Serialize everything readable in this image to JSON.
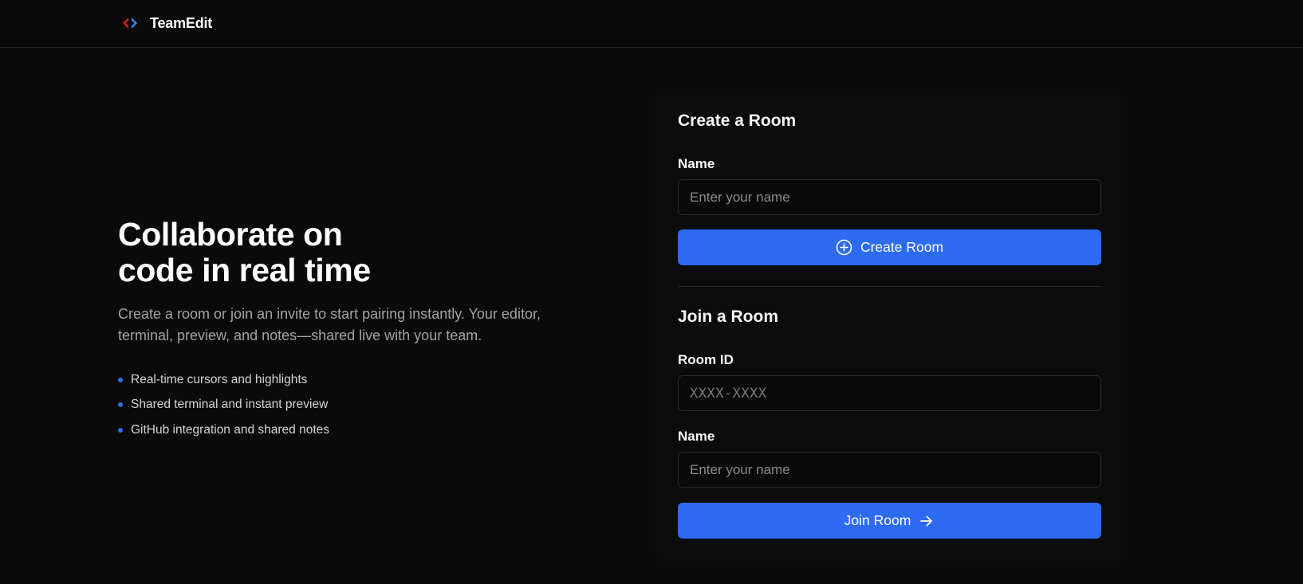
{
  "header": {
    "brand_name": "TeamEdit",
    "logo_icon": "code-brackets-icon",
    "logo_colors": {
      "left": "#d0261c",
      "right": "#2f8bf0"
    }
  },
  "hero": {
    "title_line_1": "Collaborate on",
    "title_line_2": "code in real time",
    "description": "Create a room or join an invite to start pairing instantly. Your editor, terminal, preview, and notes—shared live with your team.",
    "features": [
      "Real-time cursors and highlights",
      "Shared terminal and instant preview",
      "GitHub integration and shared notes"
    ]
  },
  "create_room": {
    "title": "Create a Room",
    "name_label": "Name",
    "name_placeholder": "Enter your name",
    "name_value": "",
    "button_label": "Create Room",
    "button_icon": "plus-circle-icon"
  },
  "join_room": {
    "title": "Join a Room",
    "room_id_label": "Room ID",
    "room_id_placeholder": "XXXX-XXXX",
    "room_id_value": "",
    "name_label": "Name",
    "name_placeholder": "Enter your name",
    "name_value": "",
    "button_label": "Join Room",
    "button_icon": "arrow-right-icon"
  },
  "colors": {
    "accent": "#2c6bf2",
    "background": "#0a0a0a",
    "card": "#0c0c0c"
  }
}
